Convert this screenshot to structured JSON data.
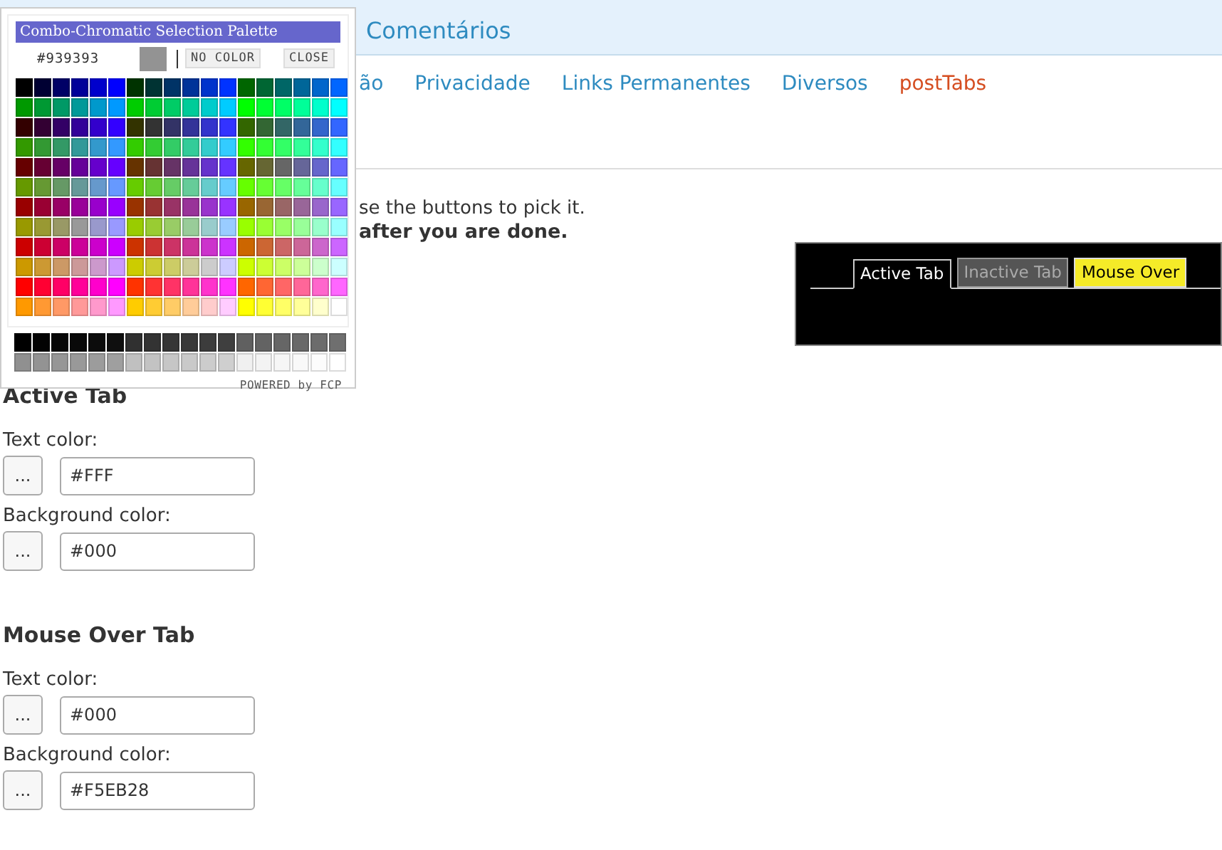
{
  "header": {
    "title": "Comentários"
  },
  "nav": [
    {
      "label": "ão",
      "selected": false
    },
    {
      "label": "Privacidade",
      "selected": false
    },
    {
      "label": "Links Permanentes",
      "selected": false
    },
    {
      "label": "Diversos",
      "selected": false
    },
    {
      "label": "postTabs",
      "selected": true
    }
  ],
  "intro": {
    "line_1": "se the buttons to pick it.",
    "line_2": "after you are done."
  },
  "preview": {
    "tabs": [
      {
        "label": "Active Tab",
        "kind": "active"
      },
      {
        "label": "Inactive Tab",
        "kind": "inactive"
      },
      {
        "label": "Mouse Over",
        "kind": "hover"
      }
    ]
  },
  "sections": [
    {
      "title": "Active Tab",
      "fields": [
        {
          "label": "Text color:",
          "button": "...",
          "value": "#FFF"
        },
        {
          "label": "Background color:",
          "button": "...",
          "value": "#000"
        }
      ]
    },
    {
      "title": "Mouse Over Tab",
      "fields": [
        {
          "label": "Text color:",
          "button": "...",
          "value": "#000"
        },
        {
          "label": "Background color:",
          "button": "...",
          "value": "#F5EB28"
        }
      ]
    }
  ],
  "palette": {
    "title": "Combo-Chromatic Selection Palette",
    "current_value": "#939393",
    "no_color_button": "NO COLOR",
    "close_button": "CLOSE",
    "footer": "POWERED by FCP",
    "rows": [
      {
        "swatches": [
          {
            "color": "#000000"
          },
          {
            "color": "#000033"
          },
          {
            "color": "#000066"
          },
          {
            "color": "#000099"
          },
          {
            "color": "#0000cc"
          },
          {
            "color": "#0000ff"
          },
          {
            "color": "#003300"
          },
          {
            "color": "#003333"
          },
          {
            "color": "#003366"
          },
          {
            "color": "#003399"
          },
          {
            "color": "#0033cc"
          },
          {
            "color": "#0033ff"
          },
          {
            "color": "#006600"
          },
          {
            "color": "#006633"
          },
          {
            "color": "#006666"
          },
          {
            "color": "#006699"
          },
          {
            "color": "#0066cc"
          },
          {
            "color": "#0066ff"
          }
        ]
      },
      {
        "swatches": [
          {
            "color": "#009900"
          },
          {
            "color": "#009933"
          },
          {
            "color": "#009966"
          },
          {
            "color": "#009999"
          },
          {
            "color": "#0099cc"
          },
          {
            "color": "#0099ff"
          },
          {
            "color": "#00cc00"
          },
          {
            "color": "#00cc33"
          },
          {
            "color": "#00cc66"
          },
          {
            "color": "#00cc99"
          },
          {
            "color": "#00cccc"
          },
          {
            "color": "#00ccff"
          },
          {
            "color": "#00ff00"
          },
          {
            "color": "#00ff33"
          },
          {
            "color": "#00ff66"
          },
          {
            "color": "#00ff99"
          },
          {
            "color": "#00ffcc"
          },
          {
            "color": "#00ffff"
          }
        ]
      },
      {
        "swatches": [
          {
            "color": "#330000"
          },
          {
            "color": "#330033"
          },
          {
            "color": "#330066"
          },
          {
            "color": "#330099"
          },
          {
            "color": "#3300cc"
          },
          {
            "color": "#3300ff"
          },
          {
            "color": "#333300"
          },
          {
            "color": "#333333"
          },
          {
            "color": "#333366"
          },
          {
            "color": "#333399"
          },
          {
            "color": "#3333cc"
          },
          {
            "color": "#3333ff"
          },
          {
            "color": "#336600"
          },
          {
            "color": "#336633"
          },
          {
            "color": "#336666"
          },
          {
            "color": "#336699"
          },
          {
            "color": "#3366cc"
          },
          {
            "color": "#3366ff"
          }
        ]
      },
      {
        "swatches": [
          {
            "color": "#339900"
          },
          {
            "color": "#339933"
          },
          {
            "color": "#339966"
          },
          {
            "color": "#339999"
          },
          {
            "color": "#3399cc"
          },
          {
            "color": "#3399ff"
          },
          {
            "color": "#33cc00"
          },
          {
            "color": "#33cc33"
          },
          {
            "color": "#33cc66"
          },
          {
            "color": "#33cc99"
          },
          {
            "color": "#33cccc"
          },
          {
            "color": "#33ccff"
          },
          {
            "color": "#33ff00"
          },
          {
            "color": "#33ff33"
          },
          {
            "color": "#33ff66"
          },
          {
            "color": "#33ff99"
          },
          {
            "color": "#33ffcc"
          },
          {
            "color": "#33ffff"
          }
        ]
      },
      {
        "swatches": [
          {
            "color": "#660000"
          },
          {
            "color": "#660033"
          },
          {
            "color": "#660066"
          },
          {
            "color": "#660099"
          },
          {
            "color": "#6600cc"
          },
          {
            "color": "#6600ff"
          },
          {
            "color": "#663300"
          },
          {
            "color": "#663333"
          },
          {
            "color": "#663366"
          },
          {
            "color": "#663399"
          },
          {
            "color": "#6633cc"
          },
          {
            "color": "#6633ff"
          },
          {
            "color": "#666600"
          },
          {
            "color": "#666633"
          },
          {
            "color": "#666666"
          },
          {
            "color": "#666699"
          },
          {
            "color": "#6666cc"
          },
          {
            "color": "#6666ff"
          }
        ]
      },
      {
        "swatches": [
          {
            "color": "#669900"
          },
          {
            "color": "#669933"
          },
          {
            "color": "#669966"
          },
          {
            "color": "#669999"
          },
          {
            "color": "#6699cc"
          },
          {
            "color": "#6699ff"
          },
          {
            "color": "#66cc00"
          },
          {
            "color": "#66cc33"
          },
          {
            "color": "#66cc66"
          },
          {
            "color": "#66cc99"
          },
          {
            "color": "#66cccc"
          },
          {
            "color": "#66ccff"
          },
          {
            "color": "#66ff00"
          },
          {
            "color": "#66ff33"
          },
          {
            "color": "#66ff66"
          },
          {
            "color": "#66ff99"
          },
          {
            "color": "#66ffcc"
          },
          {
            "color": "#66ffff"
          }
        ]
      },
      {
        "swatches": [
          {
            "color": "#990000"
          },
          {
            "color": "#990033"
          },
          {
            "color": "#990066"
          },
          {
            "color": "#990099"
          },
          {
            "color": "#9900cc"
          },
          {
            "color": "#9900ff"
          },
          {
            "color": "#993300"
          },
          {
            "color": "#993333"
          },
          {
            "color": "#993366"
          },
          {
            "color": "#993399"
          },
          {
            "color": "#9933cc"
          },
          {
            "color": "#9933ff"
          },
          {
            "color": "#996600"
          },
          {
            "color": "#996633"
          },
          {
            "color": "#996666"
          },
          {
            "color": "#996699"
          },
          {
            "color": "#9966cc"
          },
          {
            "color": "#9966ff"
          }
        ]
      },
      {
        "swatches": [
          {
            "color": "#999900"
          },
          {
            "color": "#999933"
          },
          {
            "color": "#999966"
          },
          {
            "color": "#999999"
          },
          {
            "color": "#9999cc"
          },
          {
            "color": "#9999ff"
          },
          {
            "color": "#99cc00"
          },
          {
            "color": "#99cc33"
          },
          {
            "color": "#99cc66"
          },
          {
            "color": "#99cc99"
          },
          {
            "color": "#99cccc"
          },
          {
            "color": "#99ccff"
          },
          {
            "color": "#99ff00"
          },
          {
            "color": "#99ff33"
          },
          {
            "color": "#99ff66"
          },
          {
            "color": "#99ff99"
          },
          {
            "color": "#99ffcc"
          },
          {
            "color": "#99ffff"
          }
        ]
      },
      {
        "swatches": [
          {
            "color": "#cc0000"
          },
          {
            "color": "#cc0033"
          },
          {
            "color": "#cc0066"
          },
          {
            "color": "#cc0099"
          },
          {
            "color": "#cc00cc"
          },
          {
            "color": "#cc00ff"
          },
          {
            "color": "#cc3300"
          },
          {
            "color": "#cc3333"
          },
          {
            "color": "#cc3366"
          },
          {
            "color": "#cc3399"
          },
          {
            "color": "#cc33cc"
          },
          {
            "color": "#cc33ff"
          },
          {
            "color": "#cc6600"
          },
          {
            "color": "#cc6633"
          },
          {
            "color": "#cc6666"
          },
          {
            "color": "#cc6699"
          },
          {
            "color": "#cc66cc"
          },
          {
            "color": "#cc66ff"
          }
        ]
      },
      {
        "swatches": [
          {
            "color": "#cc9900"
          },
          {
            "color": "#cc9933"
          },
          {
            "color": "#cc9966"
          },
          {
            "color": "#cc9999"
          },
          {
            "color": "#cc99cc"
          },
          {
            "color": "#cc99ff"
          },
          {
            "color": "#cccc00"
          },
          {
            "color": "#cccc33"
          },
          {
            "color": "#cccc66"
          },
          {
            "color": "#cccc99"
          },
          {
            "color": "#cccccc"
          },
          {
            "color": "#ccccff"
          },
          {
            "color": "#ccff00"
          },
          {
            "color": "#ccff33"
          },
          {
            "color": "#ccff66"
          },
          {
            "color": "#ccff99"
          },
          {
            "color": "#ccffcc"
          },
          {
            "color": "#ccffff"
          }
        ]
      },
      {
        "swatches": [
          {
            "color": "#ff0000"
          },
          {
            "color": "#ff0033"
          },
          {
            "color": "#ff0066"
          },
          {
            "color": "#ff0099"
          },
          {
            "color": "#ff00cc"
          },
          {
            "color": "#ff00ff"
          },
          {
            "color": "#ff3300"
          },
          {
            "color": "#ff3333"
          },
          {
            "color": "#ff3366"
          },
          {
            "color": "#ff3399"
          },
          {
            "color": "#ff33cc"
          },
          {
            "color": "#ff33ff"
          },
          {
            "color": "#ff6600"
          },
          {
            "color": "#ff6633"
          },
          {
            "color": "#ff6666"
          },
          {
            "color": "#ff6699"
          },
          {
            "color": "#ff66cc"
          },
          {
            "color": "#ff66ff"
          }
        ]
      },
      {
        "swatches": [
          {
            "color": "#ff9900"
          },
          {
            "color": "#ff9933"
          },
          {
            "color": "#ff9966"
          },
          {
            "color": "#ff9999"
          },
          {
            "color": "#ff99cc"
          },
          {
            "color": "#ff99ff"
          },
          {
            "color": "#ffcc00"
          },
          {
            "color": "#ffcc33"
          },
          {
            "color": "#ffcc66"
          },
          {
            "color": "#ffcc99"
          },
          {
            "color": "#ffcccc"
          },
          {
            "color": "#ffccff"
          },
          {
            "color": "#ffff00"
          },
          {
            "color": "#ffff33"
          },
          {
            "color": "#ffff66"
          },
          {
            "color": "#ffff99"
          },
          {
            "color": "#ffffcc"
          },
          {
            "color": "#ffffff"
          }
        ]
      }
    ],
    "gray_rows": [
      {
        "swatches": [
          {
            "color": "#000000"
          },
          {
            "color": "#030303"
          },
          {
            "color": "#060606"
          },
          {
            "color": "#090909"
          },
          {
            "color": "#0c0c0c"
          },
          {
            "color": "#0f0f0f"
          },
          {
            "color": "#303030"
          },
          {
            "color": "#333333"
          },
          {
            "color": "#363636"
          },
          {
            "color": "#393939"
          },
          {
            "color": "#3c3c3c"
          },
          {
            "color": "#3f3f3f"
          },
          {
            "color": "#606060"
          },
          {
            "color": "#636363"
          },
          {
            "color": "#666666"
          },
          {
            "color": "#696969"
          },
          {
            "color": "#6c6c6c"
          },
          {
            "color": "#6f6f6f"
          }
        ]
      },
      {
        "swatches": [
          {
            "color": "#909090"
          },
          {
            "color": "#939393"
          },
          {
            "color": "#969696"
          },
          {
            "color": "#999999"
          },
          {
            "color": "#9c9c9c"
          },
          {
            "color": "#9f9f9f"
          },
          {
            "color": "#c0c0c0"
          },
          {
            "color": "#c3c3c3"
          },
          {
            "color": "#c6c6c6"
          },
          {
            "color": "#c9c9c9"
          },
          {
            "color": "#cccccc"
          },
          {
            "color": "#cfcfcf"
          },
          {
            "color": "#f0f0f0"
          },
          {
            "color": "#f3f3f3"
          },
          {
            "color": "#f6f6f6"
          },
          {
            "color": "#f9f9f9"
          },
          {
            "color": "#fcfcfc"
          },
          {
            "color": "#ffffff"
          }
        ]
      }
    ]
  }
}
